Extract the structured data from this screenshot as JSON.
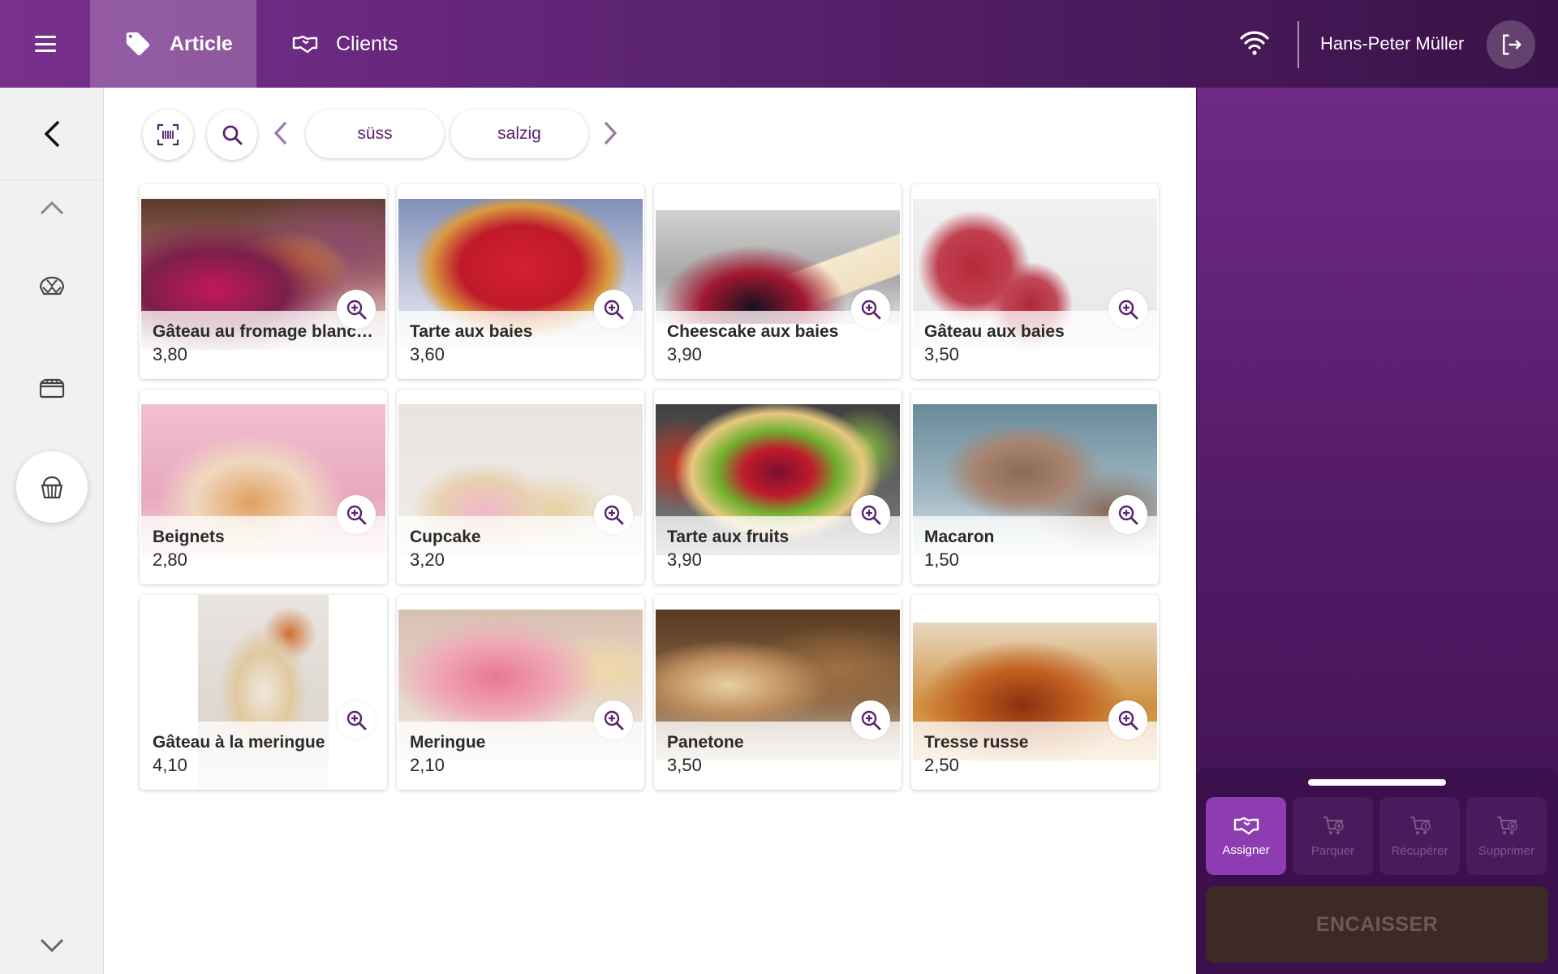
{
  "header": {
    "tabs": [
      {
        "label": "Article",
        "icon": "tag-icon",
        "active": true
      },
      {
        "label": "Clients",
        "icon": "handshake-icon",
        "active": false
      }
    ],
    "user_name": "Hans-Peter Müller"
  },
  "toolbar": {
    "categories": [
      "süss",
      "salzig"
    ]
  },
  "products": [
    {
      "name": "Gâteau au fromage blanc…",
      "price": "3,80"
    },
    {
      "name": "Tarte aux baies",
      "price": "3,60"
    },
    {
      "name": "Cheescake aux baies",
      "price": "3,90"
    },
    {
      "name": "Gâteau aux baies",
      "price": "3,50"
    },
    {
      "name": "Beignets",
      "price": "2,80"
    },
    {
      "name": "Cupcake",
      "price": "3,20"
    },
    {
      "name": "Tarte aux fruits",
      "price": "3,90"
    },
    {
      "name": "Macaron",
      "price": "1,50"
    },
    {
      "name": "Gâteau à la meringue",
      "price": "4,10"
    },
    {
      "name": "Meringue",
      "price": "2,10"
    },
    {
      "name": "Panetone",
      "price": "3,50"
    },
    {
      "name": "Tresse russe",
      "price": "2,50"
    }
  ],
  "cart_actions": {
    "assign": "Assigner",
    "park": "Parquer",
    "retrieve": "Récupérer",
    "delete": "Supprimer",
    "checkout": "ENCAISSER"
  },
  "colors": {
    "brand": "#6a2683",
    "accent": "#8e3cb2"
  }
}
